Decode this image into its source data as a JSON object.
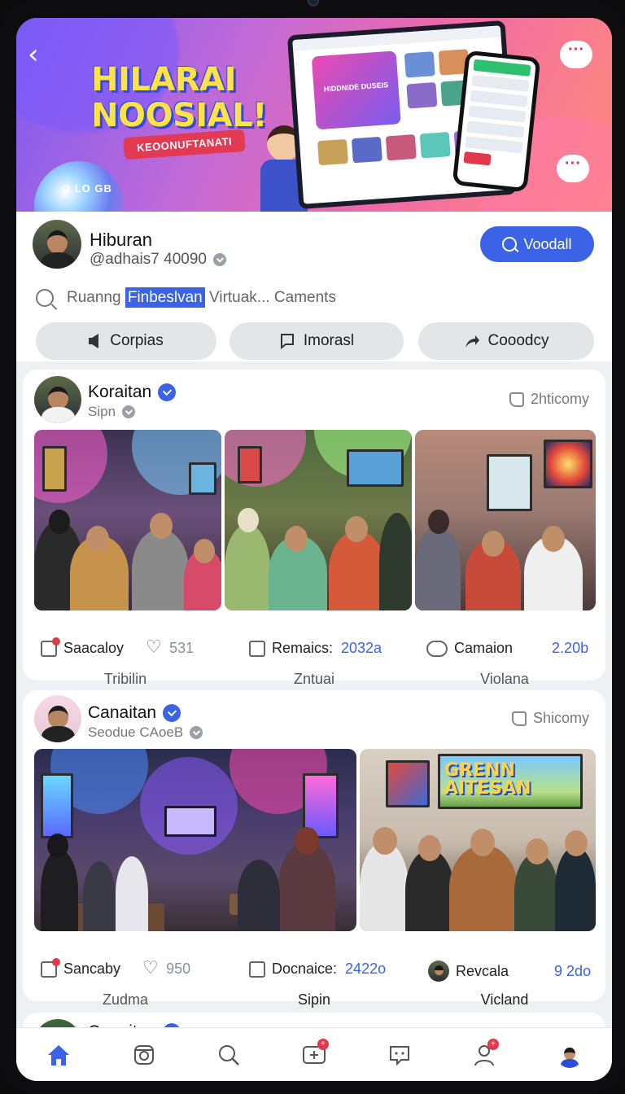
{
  "banner": {
    "title": "HILARAI NOOSIAL!",
    "ribbon": "KEOONUFTANATI",
    "sphere_label": "O LO GB",
    "tablet_hero_label": "HIDDNIDE DUSEIS",
    "bubble_icon": "ellipsis"
  },
  "profile": {
    "name": "Hiburan",
    "handle": "@adhais7 40090",
    "primary_button": "Voodall",
    "search": {
      "before": "Ruanng ",
      "highlight": "Finbeslvan",
      "after": " Virtuak... Caments"
    },
    "chips": [
      {
        "label": "Corpias",
        "icon": "speaker-icon"
      },
      {
        "label": "Imorasl",
        "icon": "chat-icon"
      },
      {
        "label": "Cooodcy",
        "icon": "share-icon"
      }
    ]
  },
  "posts": [
    {
      "name": "Koraitan",
      "sub": "Sipn",
      "like_meta": "2hticomy",
      "actions": [
        {
          "label": "Saacaloy",
          "count": "531",
          "caption": "Tribilin"
        },
        {
          "label": "Remaics:",
          "count": "2032a",
          "caption": "Zntuai"
        },
        {
          "label": "Camaion",
          "count": "2.20b",
          "caption": "Violana"
        }
      ]
    },
    {
      "name": "Canaitan",
      "sub": "Seodue CAoeB",
      "like_meta": "Shicomy",
      "tv_text": "GRENN AITESAN",
      "actions": [
        {
          "label": "Sancaby",
          "count": "950",
          "caption": "Zudma"
        },
        {
          "label": "Docnaice:",
          "count": "2422o",
          "caption": "Sipin"
        },
        {
          "label": "Revcala",
          "count": "9 2do",
          "caption": "Vicland"
        }
      ]
    },
    {
      "name": "Canaitan",
      "sub": ""
    }
  ],
  "colors": {
    "accent": "#3a63e6",
    "notification": "#e03a4a",
    "banner_start": "#7b5cf0",
    "banner_end": "#ff8c7a"
  },
  "bottom_nav": [
    {
      "icon": "home-icon",
      "active": true
    },
    {
      "icon": "reels-icon"
    },
    {
      "icon": "search-icon"
    },
    {
      "icon": "add-post-icon",
      "badge": "+"
    },
    {
      "icon": "messenger-icon"
    },
    {
      "icon": "profile-icon",
      "badge": "+"
    },
    {
      "icon": "avatar-icon"
    }
  ]
}
